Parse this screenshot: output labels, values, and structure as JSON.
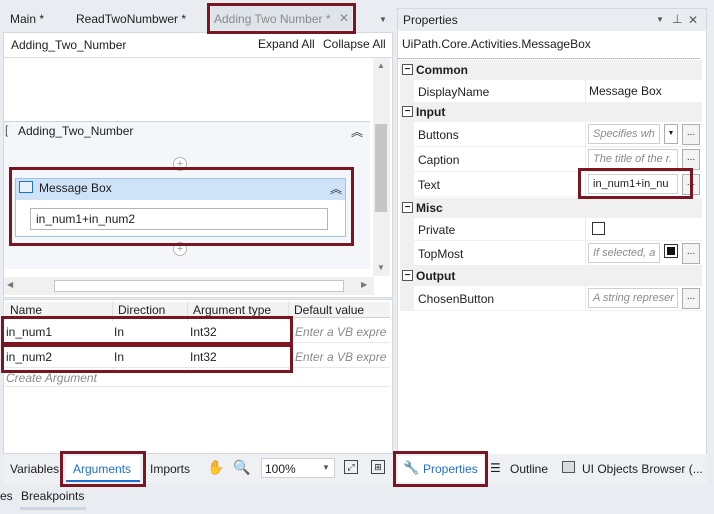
{
  "tabs": [
    {
      "label": "Main *"
    },
    {
      "label": "ReadTwoNumbwer *"
    },
    {
      "label": "Adding Two Number *"
    }
  ],
  "designer": {
    "breadcrumb": "Adding_Two_Number",
    "expand_all": "Expand All",
    "collapse_all": "Collapse All",
    "sequence_title": "Adding_Two_Number",
    "activity_title": "Message Box",
    "activity_text": "in_num1+in_num2"
  },
  "arguments": {
    "headers": [
      "Name",
      "Direction",
      "Argument type",
      "Default value"
    ],
    "rows": [
      {
        "name": "in_num1",
        "direction": "In",
        "type": "Int32",
        "default_placeholder": "Enter a VB expre:"
      },
      {
        "name": "in_num2",
        "direction": "In",
        "type": "Int32",
        "default_placeholder": "Enter a VB expre:"
      }
    ],
    "create_label": "Create Argument"
  },
  "bottom_bar": {
    "variables": "Variables",
    "arguments": "Arguments",
    "imports": "Imports",
    "zoom": "100%"
  },
  "footer_tabs": {
    "partial": "es",
    "breakpoints": "Breakpoints"
  },
  "properties": {
    "title": "Properties",
    "type_name": "UiPath.Core.Activities.MessageBox",
    "categories": {
      "common": "Common",
      "input": "Input",
      "misc": "Misc",
      "output": "Output"
    },
    "display_name_label": "DisplayName",
    "display_name_value": "Message Box",
    "buttons_label": "Buttons",
    "buttons_placeholder": "Specifies wh",
    "caption_label": "Caption",
    "caption_placeholder": "The title of the r.",
    "text_label": "Text",
    "text_value": "in_num1+in_nu",
    "private_label": "Private",
    "topmost_label": "TopMost",
    "topmost_placeholder": "If selected, a",
    "chosen_label": "ChosenButton",
    "chosen_placeholder": "A string represer",
    "dots": "...",
    "tabs": {
      "properties": "Properties",
      "outline": "Outline",
      "ui_objects": "UI Objects Browser (..."
    }
  },
  "colors": {
    "highlight": "#7a1522",
    "accent_blue": "#1f6fd0",
    "activity_header": "#cfe3f8"
  }
}
